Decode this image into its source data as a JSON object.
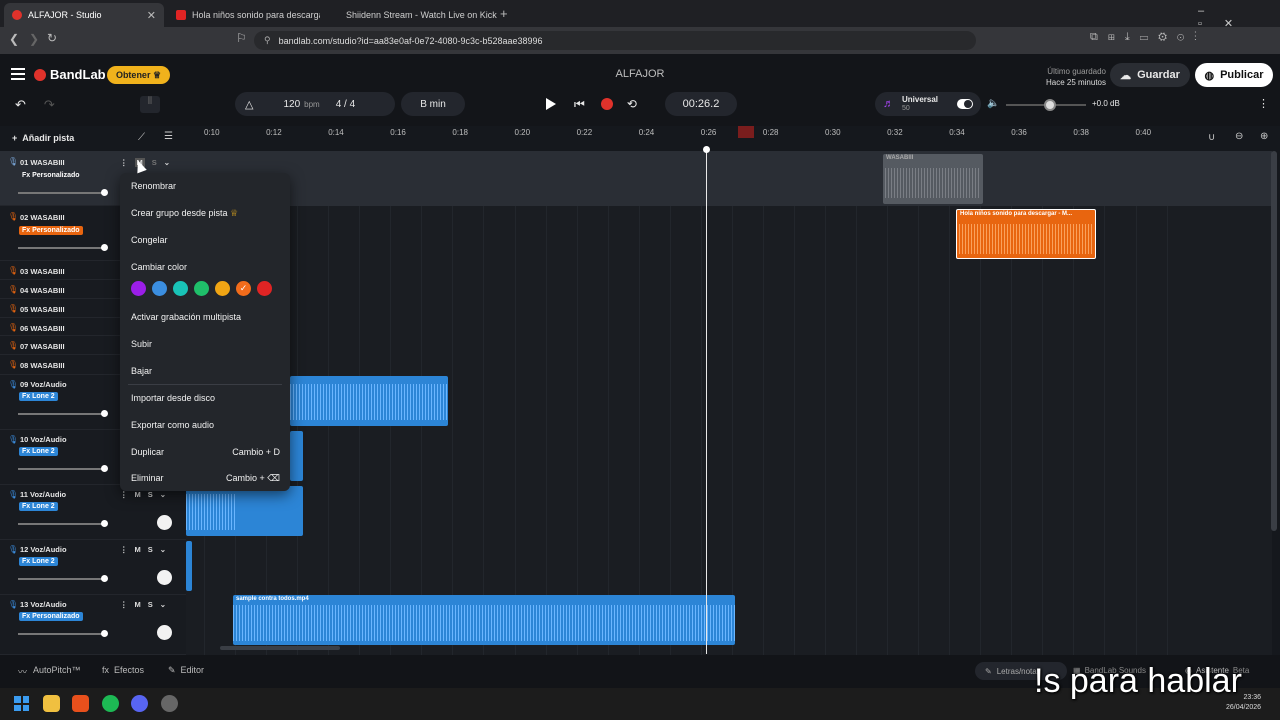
{
  "browser": {
    "tabs": [
      {
        "title": "ALFAJOR - Studio"
      },
      {
        "title": "Hola niños sonido para descargar - Y"
      },
      {
        "title": "Shiidenn Stream - Watch Live on Kick"
      }
    ],
    "new_tab_symbol": "+",
    "url": "bandlab.com/studio?id=aa83e0af-0e72-4080-9c3c-b528aae38996"
  },
  "app": {
    "brand": "BandLab",
    "obtain_label": "Obtener",
    "project_title": "ALFAJOR",
    "last_saved_label": "Último guardado",
    "last_saved_time": "Hace 25 minutos",
    "save_label": "Guardar",
    "publish_label": "Publicar",
    "tempo": "120",
    "tempo_unit": "bpm",
    "time_signature": "4 / 4",
    "key": "B min",
    "time_display": "00:26.2",
    "instrument_name": "Universal",
    "instrument_value": "50",
    "master_volume": "+0.0 dB",
    "add_track_label": "Añadir pista"
  },
  "ruler": [
    "0:10",
    "0:12",
    "0:14",
    "0:16",
    "0:18",
    "0:20",
    "0:22",
    "0:24",
    "0:26",
    "0:28",
    "0:30",
    "0:32",
    "0:34",
    "0:36",
    "0:38",
    "0:40"
  ],
  "tracks": [
    {
      "name": "01  WASABIII",
      "fx": "Fx Personalizado"
    },
    {
      "name": "02  WASABIII",
      "fx": "Fx Personalizado"
    },
    {
      "name": "03  WASABIII",
      "fx": ""
    },
    {
      "name": "04  WASABIII",
      "fx": ""
    },
    {
      "name": "05  WASABIII",
      "fx": ""
    },
    {
      "name": "06  WASABIII",
      "fx": ""
    },
    {
      "name": "07  WASABIII",
      "fx": ""
    },
    {
      "name": "08  WASABIII",
      "fx": ""
    },
    {
      "name": "09  Voz/Audio",
      "fx": "Fx Lone 2"
    },
    {
      "name": "10  Voz/Audio",
      "fx": "Fx Lone 2"
    },
    {
      "name": "11  Voz/Audio",
      "fx": "Fx Lone 2"
    },
    {
      "name": "12  Voz/Audio",
      "fx": "Fx Lone 2"
    },
    {
      "name": "13  Voz/Audio",
      "fx": "Fx Personalizado"
    }
  ],
  "mute_label": "M",
  "solo_label": "S",
  "clips": {
    "track1": "WASABIII",
    "track2": "Hola niños sonido para descargar - M...",
    "track13": "sample contra todos.mp4"
  },
  "context_menu": {
    "rename": "Renombrar",
    "create_group": "Crear grupo desde pista",
    "freeze": "Congelar",
    "change_color": "Cambiar color",
    "multitrack": "Activar grabación multipista",
    "move_up": "Subir",
    "move_down": "Bajar",
    "import_disk": "Importar desde disco",
    "export_audio": "Exportar como audio",
    "duplicate": "Duplicar",
    "duplicate_shortcut": "Cambio + D",
    "delete": "Eliminar",
    "delete_shortcut": "Cambio + ⌫",
    "colors": [
      "#9b1ee8",
      "#3b8ee0",
      "#19c3b7",
      "#1fbf6a",
      "#f0a514",
      "#f26c1b",
      "#e02424"
    ]
  },
  "bottom": {
    "autopitch": "AutoPitch™",
    "effects": "Efectos",
    "editor": "Editor",
    "lyrics": "Letras/notas",
    "sounds": "BandLab Sounds",
    "assistant": "Asistente",
    "beta": "Beta"
  },
  "taskbar": {
    "time": "23:36",
    "date": "26/04/2026"
  },
  "caption": "!s para hablar"
}
